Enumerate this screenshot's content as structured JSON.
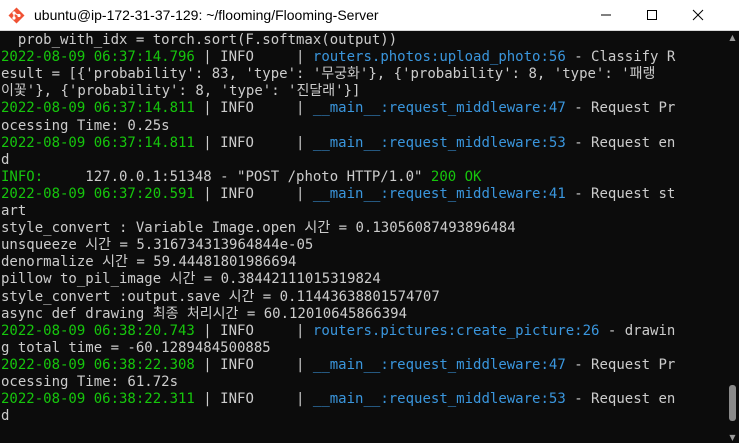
{
  "window": {
    "title": "ubuntu@ip-172-31-37-129: ~/flooming/Flooming-Server",
    "icons": {
      "app": "git-bash-diamond-icon",
      "minimize": "minimize-icon",
      "maximize": "maximize-icon",
      "close": "close-icon"
    }
  },
  "colors": {
    "background": "#0c0c0c",
    "text": "#cccccc",
    "green": "#16c60c",
    "cyan": "#3a96dd"
  },
  "terminal": {
    "lines": [
      [
        [
          "w",
          "  prob_with_idx = torch.sort(F.softmax(output))"
        ]
      ],
      [
        [
          "g",
          "2022-08-09 06:37:14.796"
        ],
        [
          "w",
          " | INFO     | "
        ],
        [
          "c",
          "routers.photos:upload_photo:56"
        ],
        [
          "w",
          " - Classify R"
        ]
      ],
      [
        [
          "w",
          "esult = [{'probability': 83, 'type': '무궁화'}, {'probability': 8, 'type': '패랭"
        ]
      ],
      [
        [
          "w",
          "이꽃'}, {'probability': 8, 'type': '진달래'}]"
        ]
      ],
      [
        [
          "g",
          "2022-08-09 06:37:14.811"
        ],
        [
          "w",
          " | INFO     | "
        ],
        [
          "c",
          "__main__:request_middleware:47"
        ],
        [
          "w",
          " - Request Pr"
        ]
      ],
      [
        [
          "w",
          "ocessing Time: 0.25s"
        ]
      ],
      [
        [
          "g",
          "2022-08-09 06:37:14.811"
        ],
        [
          "w",
          " | INFO     | "
        ],
        [
          "c",
          "__main__:request_middleware:53"
        ],
        [
          "w",
          " - Request en"
        ]
      ],
      [
        [
          "w",
          "d"
        ]
      ],
      [
        [
          "g",
          "INFO:"
        ],
        [
          "w",
          "     127.0.0.1:51348 - \"POST /photo HTTP/1.0\" "
        ],
        [
          "g",
          "200 OK"
        ]
      ],
      [
        [
          "g",
          "2022-08-09 06:37:20.591"
        ],
        [
          "w",
          " | INFO     | "
        ],
        [
          "c",
          "__main__:request_middleware:41"
        ],
        [
          "w",
          " - Request st"
        ]
      ],
      [
        [
          "w",
          "art"
        ]
      ],
      [
        [
          "w",
          "style_convert : Variable Image.open 시간 = 0.13056087493896484"
        ]
      ],
      [
        [
          "w",
          "unsqueeze 시간 = 5.316734313964844e-05"
        ]
      ],
      [
        [
          "w",
          "denormalize 시간 = 59.44481801986694"
        ]
      ],
      [
        [
          "w",
          "pillow to_pil_image 시간 = 0.38442111015319824"
        ]
      ],
      [
        [
          "w",
          "style_convert :output.save 시간 = 0.11443638801574707"
        ]
      ],
      [
        [
          "w",
          "async def drawing 최종 처리시간 = 60.12010645866394"
        ]
      ],
      [
        [
          "g",
          "2022-08-09 06:38:20.743"
        ],
        [
          "w",
          " | INFO     | "
        ],
        [
          "c",
          "routers.pictures:create_picture:26"
        ],
        [
          "w",
          " - drawin"
        ]
      ],
      [
        [
          "w",
          "g total time = -60.1289484500885"
        ]
      ],
      [
        [
          "g",
          "2022-08-09 06:38:22.308"
        ],
        [
          "w",
          " | INFO     | "
        ],
        [
          "c",
          "__main__:request_middleware:47"
        ],
        [
          "w",
          " - Request Pr"
        ]
      ],
      [
        [
          "w",
          "ocessing Time: 61.72s"
        ]
      ],
      [
        [
          "g",
          "2022-08-09 06:38:22.311"
        ],
        [
          "w",
          " | INFO     | "
        ],
        [
          "c",
          "__main__:request_middleware:53"
        ],
        [
          "w",
          " - Request en"
        ]
      ],
      [
        [
          "w",
          "d"
        ]
      ]
    ]
  }
}
